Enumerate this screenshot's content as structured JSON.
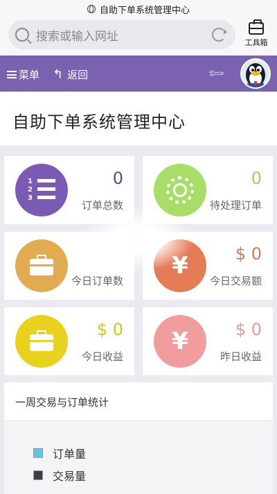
{
  "browser": {
    "url_title": "自助下单系统管理中心",
    "search_placeholder": "搜索或输入网址",
    "toolbox_label": "工具箱"
  },
  "header": {
    "menu_label": "菜单",
    "back_label": "返回",
    "bg_color": "#7b62b0"
  },
  "page": {
    "title": "自助下单系统管理中心"
  },
  "stats": [
    {
      "value": "0",
      "label": "订单总数",
      "color": "#7b5ab3",
      "value_color": "#5b4a8a",
      "icon": "list-icon"
    },
    {
      "value": "0",
      "label": "待处理订单",
      "color": "#a9dd6a",
      "value_color": "#9ccf6a",
      "icon": "gear-icon"
    },
    {
      "value": "",
      "label": "今日订单数",
      "color": "#e2ab52",
      "value_color": "#e2ab52",
      "icon": "briefcase-icon"
    },
    {
      "value": "$ 0",
      "label": "今日交易额",
      "color": "#e47c58",
      "value_color": "#d4775a",
      "icon": "yen-icon"
    },
    {
      "value": "$ 0",
      "label": "今日收益",
      "color": "#e8d21f",
      "value_color": "#d8c41a",
      "icon": "briefcase-icon"
    },
    {
      "value": "$ 0",
      "label": "昨日收益",
      "color": "#f29d9d",
      "value_color": "#e59a9a",
      "icon": "yen-icon"
    }
  ],
  "weekly": {
    "title": "一周交易与订单统计",
    "legend": [
      {
        "label": "订单量",
        "color": "#5ec8e0"
      },
      {
        "label": "交易量",
        "color": "#3a3d4a"
      }
    ]
  }
}
